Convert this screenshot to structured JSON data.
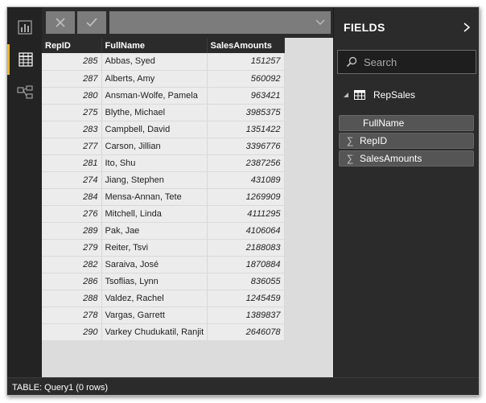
{
  "rail": {
    "items": [
      {
        "name": "report-view",
        "icon": "bar-chart-icon"
      },
      {
        "name": "data-view",
        "icon": "table-grid-icon",
        "active": true
      },
      {
        "name": "relationships-view",
        "icon": "relationships-icon"
      }
    ]
  },
  "formula_bar": {
    "cancel_icon": "x-icon",
    "commit_icon": "check-icon",
    "value": ""
  },
  "table": {
    "columns": [
      "RepID",
      "FullName",
      "SalesAmounts"
    ],
    "rows": [
      {
        "repid": "285",
        "name": "Abbas, Syed",
        "sales": "151257"
      },
      {
        "repid": "287",
        "name": "Alberts, Amy",
        "sales": "560092"
      },
      {
        "repid": "280",
        "name": "Ansman-Wolfe, Pamela",
        "sales": "963421"
      },
      {
        "repid": "275",
        "name": "Blythe, Michael",
        "sales": "3985375"
      },
      {
        "repid": "283",
        "name": "Campbell, David",
        "sales": "1351422"
      },
      {
        "repid": "277",
        "name": "Carson, Jillian",
        "sales": "3396776"
      },
      {
        "repid": "281",
        "name": "Ito, Shu",
        "sales": "2387256"
      },
      {
        "repid": "274",
        "name": "Jiang, Stephen",
        "sales": "431089"
      },
      {
        "repid": "284",
        "name": "Mensa-Annan, Tete",
        "sales": "1269909"
      },
      {
        "repid": "276",
        "name": "Mitchell, Linda",
        "sales": "4111295"
      },
      {
        "repid": "289",
        "name": "Pak, Jae",
        "sales": "4106064"
      },
      {
        "repid": "279",
        "name": "Reiter, Tsvi",
        "sales": "2188083"
      },
      {
        "repid": "282",
        "name": "Saraiva, José",
        "sales": "1870884"
      },
      {
        "repid": "286",
        "name": "Tsoflias, Lynn",
        "sales": "836055"
      },
      {
        "repid": "288",
        "name": "Valdez, Rachel",
        "sales": "1245459"
      },
      {
        "repid": "278",
        "name": "Vargas, Garrett",
        "sales": "1389837"
      },
      {
        "repid": "290",
        "name": "Varkey Chudukatil, Ranjit",
        "sales": "2646078"
      }
    ]
  },
  "fields": {
    "title": "FIELDS",
    "search_placeholder": "Search",
    "table_name": "RepSales",
    "items": [
      {
        "label": "FullName",
        "aggregate": false
      },
      {
        "label": "RepID",
        "aggregate": true
      },
      {
        "label": "SalesAmounts",
        "aggregate": true
      }
    ]
  },
  "status": {
    "text": "TABLE: Query1 (0 rows)"
  },
  "colors": {
    "accent": "#e8b62c",
    "pane_bg": "#2b2b2b",
    "grid_bg": "#ececec"
  }
}
